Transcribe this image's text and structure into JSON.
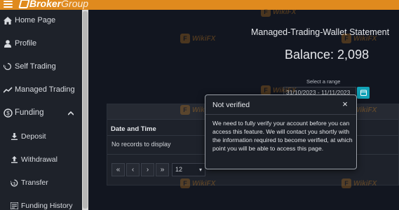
{
  "header": {
    "brand_bold": "Broker",
    "brand_light": "Group",
    "accent": "#e08a1e"
  },
  "sidebar": {
    "items": [
      {
        "label": "Home Page",
        "icon": "home-icon"
      },
      {
        "label": "Profile",
        "icon": "user-icon"
      },
      {
        "label": "Self Trading",
        "icon": "refresh-icon"
      },
      {
        "label": "Managed Trading",
        "icon": "chart-line-icon"
      },
      {
        "label": "Funding",
        "icon": "coins-icon"
      },
      {
        "label": "Deposit",
        "icon": "download-icon"
      },
      {
        "label": "Withdrawal",
        "icon": "upload-icon"
      },
      {
        "label": "Transfer",
        "icon": "transfer-icon"
      },
      {
        "label": "Funding History",
        "icon": "history-icon"
      }
    ]
  },
  "main": {
    "title": "Managed-Trading-Wallet Statement",
    "balance": "Balance: 2,098",
    "range_label": "Select a range",
    "range_value": "31/10/2023 - 11/11/2023"
  },
  "table": {
    "col_date": "Date and Time",
    "empty": "No records to display",
    "pager": {
      "first": "«",
      "prev": "‹",
      "next": "›",
      "last": "»"
    },
    "page_size": "12"
  },
  "watermark": {
    "text": "WikiFX",
    "logo": "F"
  },
  "modal": {
    "title": "Not verified",
    "close": "×",
    "body": "We need to fully verify your account before you can access this feature. We will contact you shortly with the information required to become verified, at which point you will be able to access this page."
  }
}
